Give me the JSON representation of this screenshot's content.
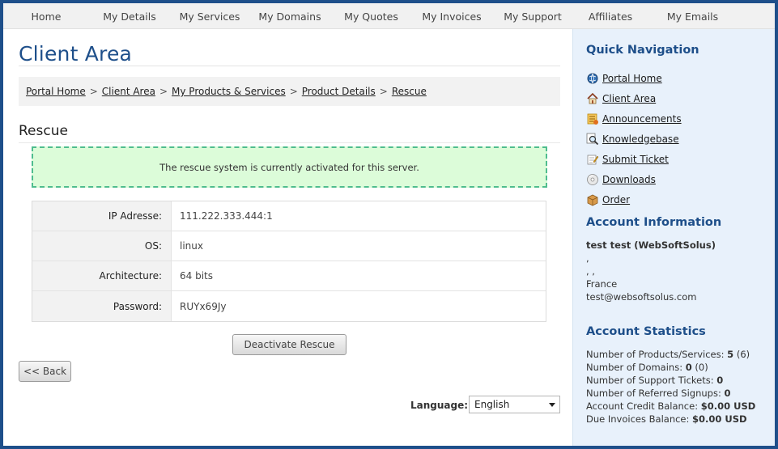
{
  "nav": {
    "items": [
      "Home",
      "My Details",
      "My Services",
      "My Domains",
      "My Quotes",
      "My Invoices",
      "My Support",
      "Affiliates",
      "My Emails"
    ]
  },
  "page": {
    "title": "Client Area",
    "breadcrumb": [
      "Portal Home",
      "Client Area",
      "My Products & Services",
      "Product Details",
      "Rescue"
    ],
    "section_title": "Rescue",
    "alert": "The rescue system is currently activated for this server."
  },
  "details": {
    "rows": [
      {
        "label": "IP Adresse:",
        "value": "111.222.333.444:1"
      },
      {
        "label": "OS:",
        "value": "linux"
      },
      {
        "label": "Architecture:",
        "value": "64 bits"
      },
      {
        "label": "Password:",
        "value": "RUYx69Jy"
      }
    ]
  },
  "buttons": {
    "deactivate": "Deactivate Rescue",
    "back": "<< Back"
  },
  "language": {
    "label": "Language:",
    "selected": "English"
  },
  "sidebar": {
    "quick_nav_title": "Quick Navigation",
    "quick_nav": [
      {
        "label": "Portal Home",
        "icon": "globe-icon"
      },
      {
        "label": "Client Area",
        "icon": "home-icon"
      },
      {
        "label": "Announcements",
        "icon": "announcement-icon"
      },
      {
        "label": "Knowledgebase",
        "icon": "magnifier-icon"
      },
      {
        "label": "Submit Ticket",
        "icon": "ticket-icon"
      },
      {
        "label": "Downloads",
        "icon": "disc-icon"
      },
      {
        "label": "Order",
        "icon": "box-icon"
      }
    ],
    "account_title": "Account Information",
    "account": {
      "name": "test test (WebSoftSolus)",
      "line1": ",",
      "line2": ", ,",
      "country": "France",
      "email": "test@websoftsolus.com"
    },
    "stats_title": "Account Statistics",
    "stats": [
      {
        "label": "Number of Products/Services:",
        "value": "5",
        "extra": "(6)"
      },
      {
        "label": "Number of Domains:",
        "value": "0",
        "extra": "(0)"
      },
      {
        "label": "Number of Support Tickets:",
        "value": "0",
        "extra": ""
      },
      {
        "label": "Number of Referred Signups:",
        "value": "0",
        "extra": ""
      },
      {
        "label": "Account Credit Balance:",
        "value": "$0.00 USD",
        "extra": ""
      },
      {
        "label": "Due Invoices Balance:",
        "value": "$0.00 USD",
        "extra": ""
      }
    ]
  },
  "colors": {
    "brand": "#1e4f8a",
    "alert_bg": "#dcfcd9",
    "alert_border": "#4fbd8e",
    "sidebar_bg": "#e8f1fb"
  }
}
